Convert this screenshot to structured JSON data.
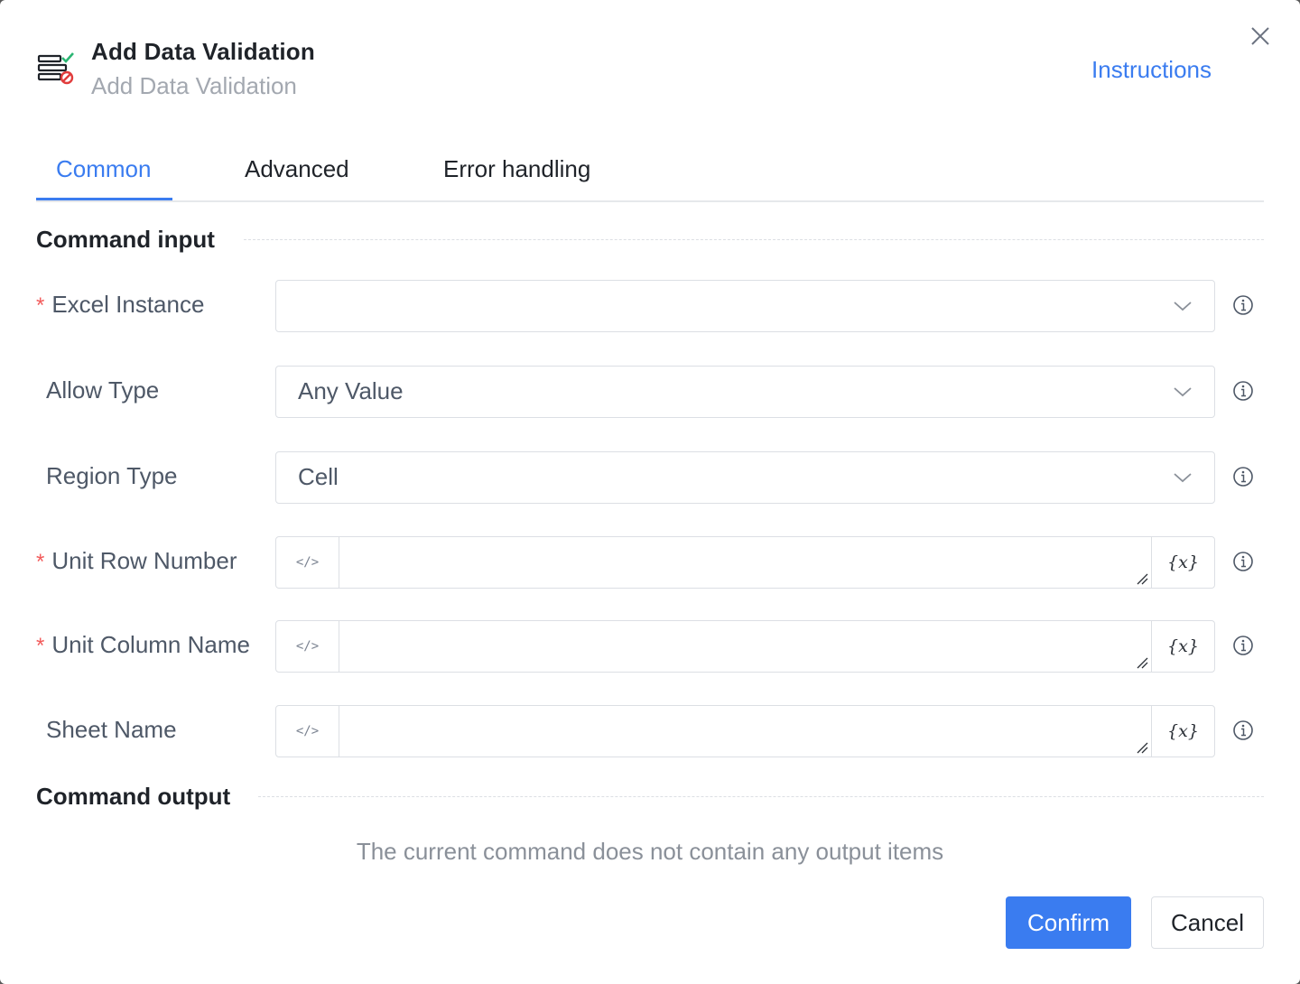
{
  "header": {
    "title": "Add Data Validation",
    "subtitle": "Add Data Validation",
    "instructions_link": "Instructions",
    "icon": "data-validation-icon",
    "close_icon": "close-icon"
  },
  "tabs": [
    {
      "label": "Common",
      "active": true
    },
    {
      "label": "Advanced",
      "active": false
    },
    {
      "label": "Error handling",
      "active": false
    }
  ],
  "sections": {
    "input_title": "Command input",
    "output_title": "Command output",
    "output_empty_text": "The current command does not contain any output items"
  },
  "fields": {
    "excel_instance": {
      "label": "Excel Instance",
      "required": "*",
      "value": ""
    },
    "allow_type": {
      "label": "Allow Type",
      "value": "Any Value"
    },
    "region_type": {
      "label": "Region Type",
      "value": "Cell"
    },
    "unit_row_number": {
      "label": "Unit Row Number",
      "required": "*",
      "value": "",
      "left_glyph": "</>",
      "right_glyph": "{x}"
    },
    "unit_column_name": {
      "label": "Unit Column Name",
      "required": "*",
      "value": "",
      "left_glyph": "</>",
      "right_glyph": "{x}"
    },
    "sheet_name": {
      "label": "Sheet Name",
      "value": "",
      "left_glyph": "</>",
      "right_glyph": "{x}"
    }
  },
  "footer": {
    "confirm_label": "Confirm",
    "cancel_label": "Cancel"
  },
  "colors": {
    "accent": "#3a7cf0",
    "required": "#f25b5b",
    "border": "#dcdfe4"
  }
}
